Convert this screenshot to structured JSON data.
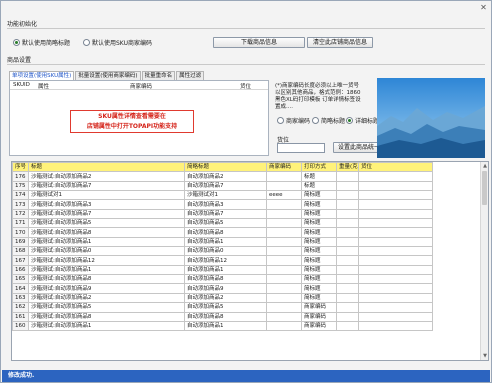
{
  "window": {
    "title": "功能初始化"
  },
  "init": {
    "radio_simple": "默认使用简略标题",
    "radio_sku": "默认使用SKU商家编码",
    "download_btn": "下载商品信息",
    "clear_btn": "清空此店铺商品信息"
  },
  "settings": {
    "title": "商品设置",
    "tabs": [
      "单项设置(使用SKU属性)",
      "批量设置(使用商家编码)",
      "批量重命名",
      "属性过滤"
    ],
    "sku_panel": {
      "col_skuid": "SKUID",
      "col_attr": "属性",
      "col_code": "商家编码",
      "col_loc": "货位",
      "notice_line1": "SKU属性详情查看需要在",
      "notice_line2": "店铺属性中打开TOPAPI功能支持"
    },
    "hint": "(*)商家编码长度必须以上唯一货号以区别其他商品，格式范例：1860黑色XL码打印模板 订单详情标签设置成....",
    "opt_merchant": "商家编码",
    "opt_simple": "简略标题",
    "opt_detail": "详细标题",
    "loc_label": "货位",
    "set_loc_btn": "设置此商品统一货位"
  },
  "table": {
    "headers": [
      "序号",
      "标题",
      "简略标题",
      "商家编码",
      "打印方式",
      "重量(克)",
      "货位"
    ],
    "rows": [
      {
        "id": "176",
        "title": "沙箱测试:自动添加商品2",
        "short": "自动添加商品2",
        "code": "",
        "print": "标题",
        "weight": "",
        "loc": ""
      },
      {
        "id": "175",
        "title": "沙箱测试:自动添加商品7",
        "short": "自动添加商品7",
        "code": "",
        "print": "标题",
        "weight": "",
        "loc": ""
      },
      {
        "id": "174",
        "title": "沙箱测试对1",
        "short": "沙箱测试对1",
        "code": "eeee",
        "print": "简标题",
        "weight": "",
        "loc": ""
      },
      {
        "id": "173",
        "title": "沙箱测试:自动添加商品3",
        "short": "自动添加商品3",
        "code": "",
        "print": "简标题",
        "weight": "",
        "loc": ""
      },
      {
        "id": "172",
        "title": "沙箱测试:自动添加商品7",
        "short": "自动添加商品7",
        "code": "",
        "print": "简标题",
        "weight": "",
        "loc": ""
      },
      {
        "id": "171",
        "title": "沙箱测试:自动添加商品5",
        "short": "自动添加商品5",
        "code": "",
        "print": "简标题",
        "weight": "",
        "loc": ""
      },
      {
        "id": "170",
        "title": "沙箱测试:自动添加商品8",
        "short": "自动添加商品8",
        "code": "",
        "print": "简标题",
        "weight": "",
        "loc": ""
      },
      {
        "id": "169",
        "title": "沙箱测试:自动添加商品1",
        "short": "自动添加商品1",
        "code": "",
        "print": "简标题",
        "weight": "",
        "loc": ""
      },
      {
        "id": "168",
        "title": "沙箱测试:自动添加商品0",
        "short": "自动添加商品0",
        "code": "",
        "print": "简标题",
        "weight": "",
        "loc": ""
      },
      {
        "id": "167",
        "title": "沙箱测试:自动添加商品12",
        "short": "自动添加商品12",
        "code": "",
        "print": "简标题",
        "weight": "",
        "loc": ""
      },
      {
        "id": "166",
        "title": "沙箱测试:自动添加商品1",
        "short": "自动添加商品1",
        "code": "",
        "print": "简标题",
        "weight": "",
        "loc": ""
      },
      {
        "id": "165",
        "title": "沙箱测试:自动添加商品8",
        "short": "自动添加商品8",
        "code": "",
        "print": "简标题",
        "weight": "",
        "loc": ""
      },
      {
        "id": "164",
        "title": "沙箱测试:自动添加商品9",
        "short": "自动添加商品9",
        "code": "",
        "print": "简标题",
        "weight": "",
        "loc": ""
      },
      {
        "id": "163",
        "title": "沙箱测试:自动添加商品2",
        "short": "自动添加商品2",
        "code": "",
        "print": "简标题",
        "weight": "",
        "loc": ""
      },
      {
        "id": "162",
        "title": "沙箱测试:自动添加商品5",
        "short": "自动添加商品5",
        "code": "",
        "print": "商家编码",
        "weight": "",
        "loc": ""
      },
      {
        "id": "161",
        "title": "沙箱测试:自动添加商品8",
        "short": "自动添加商品8",
        "code": "",
        "print": "商家编码",
        "weight": "",
        "loc": ""
      },
      {
        "id": "160",
        "title": "沙箱测试:自动添加商品1",
        "short": "自动添加商品1",
        "code": "",
        "print": "商家编码",
        "weight": "",
        "loc": ""
      }
    ]
  },
  "status": {
    "text": "修改成功."
  },
  "icons": {
    "close": "close-icon",
    "scroll_up": "arrow-up-icon",
    "scroll_down": "arrow-down-icon"
  },
  "colors": {
    "header_bg": "#fff27a",
    "status_bg": "#2c64c0",
    "notice_border": "#e03a2f",
    "notice_text": "#d5251b"
  }
}
